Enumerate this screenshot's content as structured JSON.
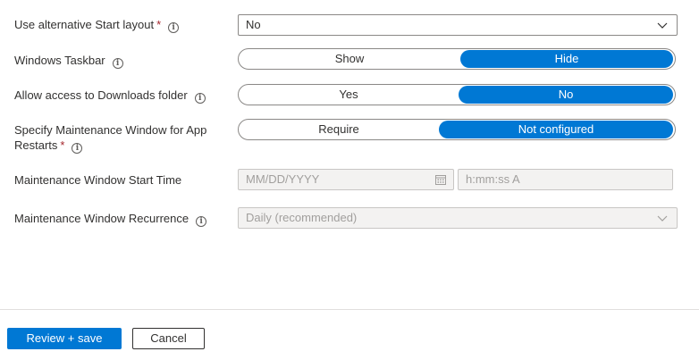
{
  "form": {
    "start_layout": {
      "label": "Use alternative Start layout",
      "required": "*",
      "value": "No"
    },
    "taskbar": {
      "label": "Windows Taskbar",
      "options": [
        "Show",
        "Hide"
      ],
      "selected": "Hide"
    },
    "downloads": {
      "label": "Allow access to Downloads folder",
      "options": [
        "Yes",
        "No"
      ],
      "selected": "No"
    },
    "maintenance": {
      "label_line1": "Specify Maintenance Window for App",
      "label_line2": "Restarts",
      "required": "*",
      "options": [
        "Require",
        "Not configured"
      ],
      "selected": "Not configured"
    },
    "start_time": {
      "label": "Maintenance Window Start Time",
      "date_placeholder": "MM/DD/YYYY",
      "time_placeholder": "h:mm:ss A"
    },
    "recurrence": {
      "label": "Maintenance Window Recurrence",
      "value": "Daily (recommended)"
    }
  },
  "footer": {
    "save_label": "Review + save",
    "cancel_label": "Cancel"
  },
  "colors": {
    "accent": "#0078d4",
    "required": "#a4262c"
  },
  "icons": {
    "info": "info-icon",
    "chevron": "chevron-down-icon",
    "calendar": "calendar-icon"
  }
}
